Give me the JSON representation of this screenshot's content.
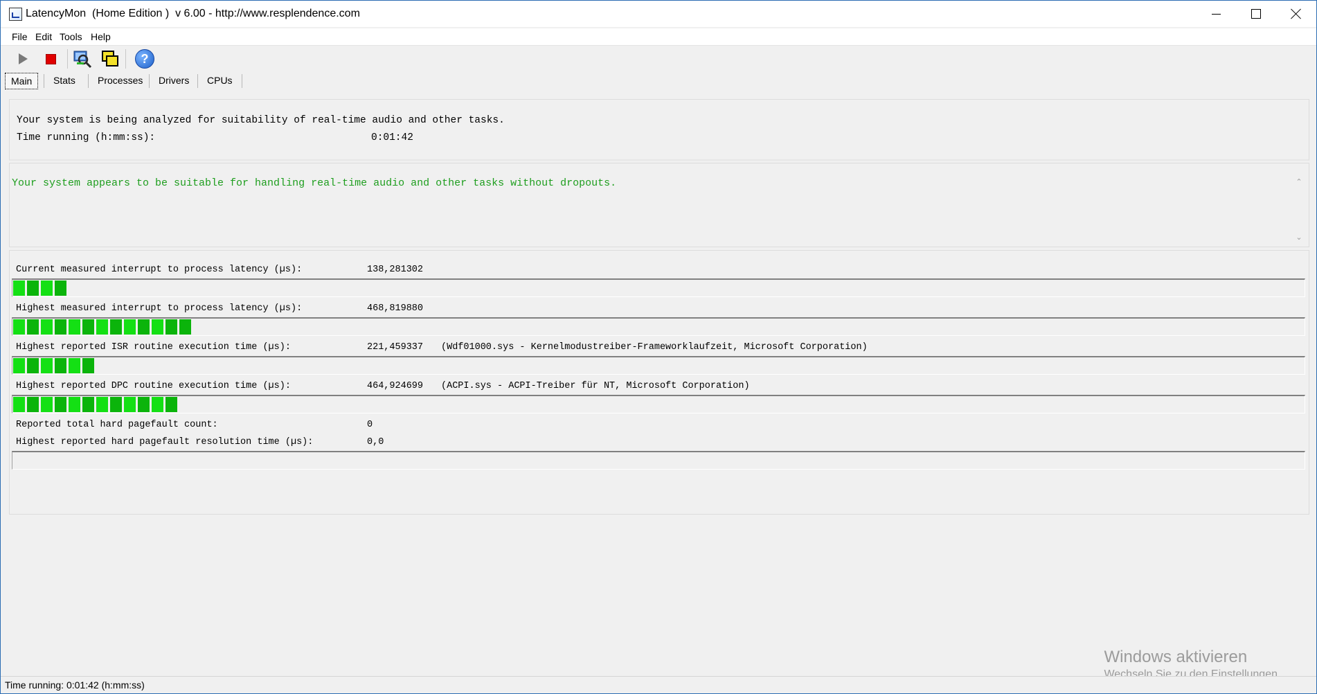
{
  "window": {
    "title": "LatencyMon  (Home Edition )  v 6.00 - http://www.resplendence.com"
  },
  "menu": {
    "items": [
      {
        "label": "File"
      },
      {
        "label": "Edit"
      },
      {
        "label": "Tools"
      },
      {
        "label": "Help"
      }
    ]
  },
  "toolbar": {
    "buttons": [
      "play-icon",
      "stop-icon",
      "analyze-icon",
      "windows-icon",
      "help-icon"
    ]
  },
  "tabs": [
    {
      "label": "Main",
      "active": true
    },
    {
      "label": "Stats"
    },
    {
      "label": "Processes"
    },
    {
      "label": "Drivers"
    },
    {
      "label": "CPUs"
    }
  ],
  "info": {
    "line1": "Your system is being analyzed for suitability of real-time audio and other tasks.",
    "time_label": "Time running (h:mm:ss):",
    "time_value": "0:01:42"
  },
  "verdict": {
    "text": "Your system appears to be suitable for handling real-time audio and other tasks without dropouts.",
    "color": "#1e9e1e"
  },
  "metrics": [
    {
      "label": "Current measured interrupt to process latency (µs):",
      "value": "138,281302",
      "detail": "",
      "segments_lit": 4
    },
    {
      "label": "Highest measured interrupt to process latency (µs):",
      "value": "468,819880",
      "detail": "",
      "segments_lit": 13
    },
    {
      "label": "Highest reported ISR routine execution time (µs):",
      "value": "221,459337",
      "detail": "(Wdf01000.sys - Kernelmodustreiber-Frameworklaufzeit, Microsoft Corporation)",
      "segments_lit": 6
    },
    {
      "label": "Highest reported DPC routine execution time (µs):",
      "value": "464,924699",
      "detail": "(ACPI.sys - ACPI-Treiber für NT, Microsoft Corporation)",
      "segments_lit": 12
    }
  ],
  "pagefault": {
    "count_label": "Reported total hard pagefault count:",
    "count_value": "0",
    "time_label": "Highest reported hard pagefault resolution time (µs):",
    "time_value": "0,0",
    "segments_lit": 0
  },
  "status": {
    "text": "Time running: 0:01:42  (h:mm:ss)"
  },
  "watermark": {
    "line1": "Windows aktivieren",
    "line2": "Wechseln Sie zu den Einstellungen"
  },
  "colors": {
    "bar_green": "#14e014",
    "bar_dark_green": "#0bb40b",
    "verdict_green": "#1e9e1e"
  }
}
